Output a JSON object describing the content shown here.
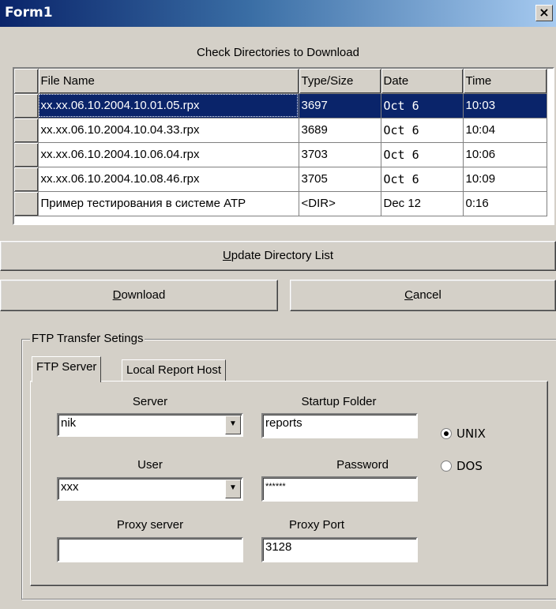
{
  "window": {
    "title": "Form1",
    "close": "×"
  },
  "grid": {
    "caption": "Check Directories to Download",
    "columns": [
      "File Name",
      "Type/Size",
      "Date",
      "Time"
    ],
    "rows": [
      [
        "xx.xx.06.10.2004.10.01.05.rpx",
        "3697",
        "Oct  6",
        "10:03"
      ],
      [
        "xx.xx.06.10.2004.10.04.33.rpx",
        "3689",
        "Oct  6",
        "10:04"
      ],
      [
        "xx.xx.06.10.2004.10.06.04.rpx",
        "3703",
        "Oct  6",
        "10:06"
      ],
      [
        "xx.xx.06.10.2004.10.08.46.rpx",
        "3705",
        "Oct  6",
        "10:09"
      ],
      [
        "Пример тестирования в системе ATP",
        "<DIR>",
        "Dec 12",
        "0:16"
      ]
    ]
  },
  "buttons": {
    "update": {
      "u": "U",
      "rest": "pdate Directory List"
    },
    "download": {
      "u": "D",
      "rest": "ownload"
    },
    "cancel": {
      "u": "C",
      "rest": "ancel"
    }
  },
  "ftp": {
    "group_label": "FTP Transfer Setings",
    "tabs": [
      "FTP Server",
      "Local Report Host"
    ],
    "server_label": "Server",
    "server_value": "nik",
    "startup_label": "Startup Folder",
    "startup_value": "reports",
    "user_label": "User",
    "user_value": "xxx",
    "password_label": "Password",
    "password_value": "******",
    "proxy_label": "Proxy server",
    "proxy_value": "",
    "port_label": "Proxy Port",
    "port_value": "3128",
    "os_options": [
      "UNIX",
      "DOS"
    ],
    "os_selected": "UNIX"
  }
}
